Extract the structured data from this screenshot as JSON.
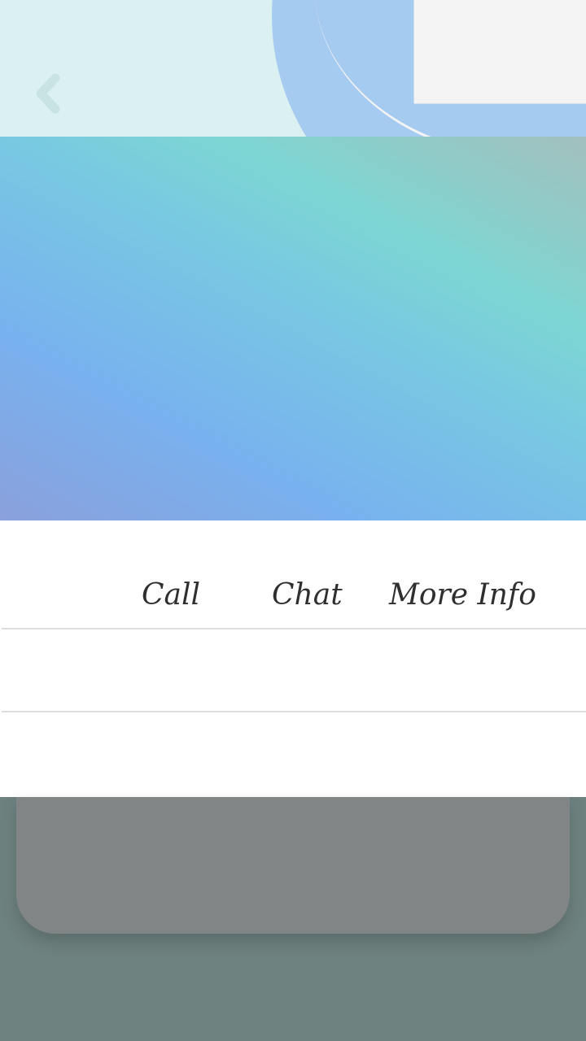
{
  "toolbar": {
    "back_icon": "chevron-left-icon"
  },
  "actions": {
    "call": "Call",
    "chat": "Chat",
    "more_info": "More Info"
  },
  "colors": {
    "top_background": "#dbf0f1",
    "top_circle": "#a6cbf0",
    "hero_gradient": [
      "#8aa0dc",
      "#78b2ef",
      "#7dd6d3",
      "#a3c0bd"
    ],
    "sheet_background": "#ffffff",
    "card_background": "#818585",
    "page_background": "#6e8280"
  }
}
